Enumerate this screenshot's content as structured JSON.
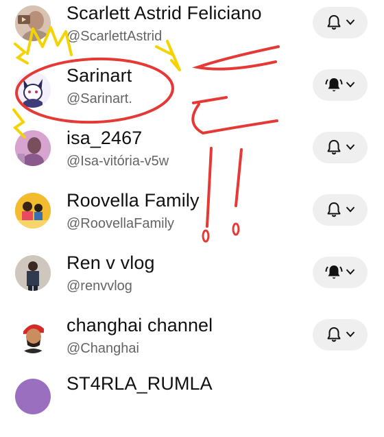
{
  "channels": [
    {
      "name": "Scarlett Astrid Feliciano",
      "handle": "@ScarlettAstrid",
      "notification": "bell-outline",
      "avatar": "avatar-photo-woman"
    },
    {
      "name": "Sarinart",
      "handle": "@Sarinart.",
      "notification": "bell-ringing-filled",
      "avatar": "avatar-anime-cat"
    },
    {
      "name": "isa_2467",
      "handle": "@Isa-vitória-v5w",
      "notification": "bell-outline",
      "avatar": "avatar-pink-photo"
    },
    {
      "name": "Roovella Family",
      "handle": "@RoovellaFamily",
      "notification": "bell-outline",
      "avatar": "avatar-family-photo"
    },
    {
      "name": "Ren v vlog",
      "handle": "@renvvlog",
      "notification": "bell-ringing-filled",
      "avatar": "avatar-man-photo"
    },
    {
      "name": "changhai channel",
      "handle": "@Changhai",
      "notification": "bell-outline",
      "avatar": "avatar-cartoon-man"
    },
    {
      "name": "ST4RLA_RUMLA",
      "handle": "",
      "notification": "",
      "avatar": "avatar-purple"
    }
  ],
  "colors": {
    "pill_bg": "#efefef",
    "scribble_red": "#e53935",
    "scribble_yellow": "#f5d300"
  }
}
